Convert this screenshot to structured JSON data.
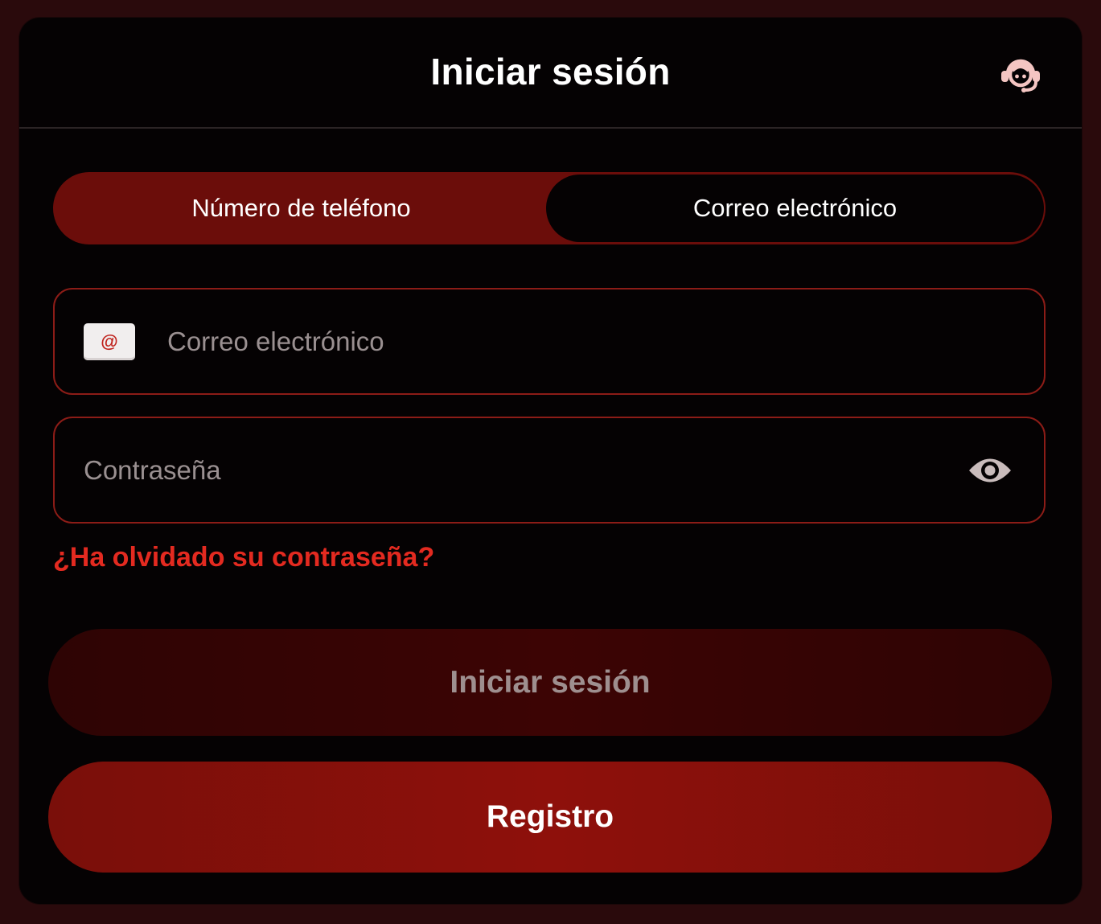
{
  "header": {
    "title": "Iniciar sesión",
    "support_icon": "headset-support-icon"
  },
  "tabs": [
    {
      "label": "Número de teléfono",
      "active": true
    },
    {
      "label": "Correo electrónico",
      "active": false
    }
  ],
  "email_field": {
    "placeholder": "Correo electrónico",
    "value": "",
    "icon": "envelope-at-icon",
    "icon_glyph": "@"
  },
  "password_field": {
    "placeholder": "Contraseña",
    "value": "",
    "icon": "eye-icon"
  },
  "forgot_link": "¿Ha olvidado su contraseña?",
  "buttons": {
    "login": "Iniciar sesión",
    "register": "Registro"
  },
  "colors": {
    "accent": "#e32a20",
    "tab_active": "#6b0d0a",
    "register_button": "#8e100b",
    "login_button": "#3c0404",
    "field_border": "#8c1c17"
  }
}
